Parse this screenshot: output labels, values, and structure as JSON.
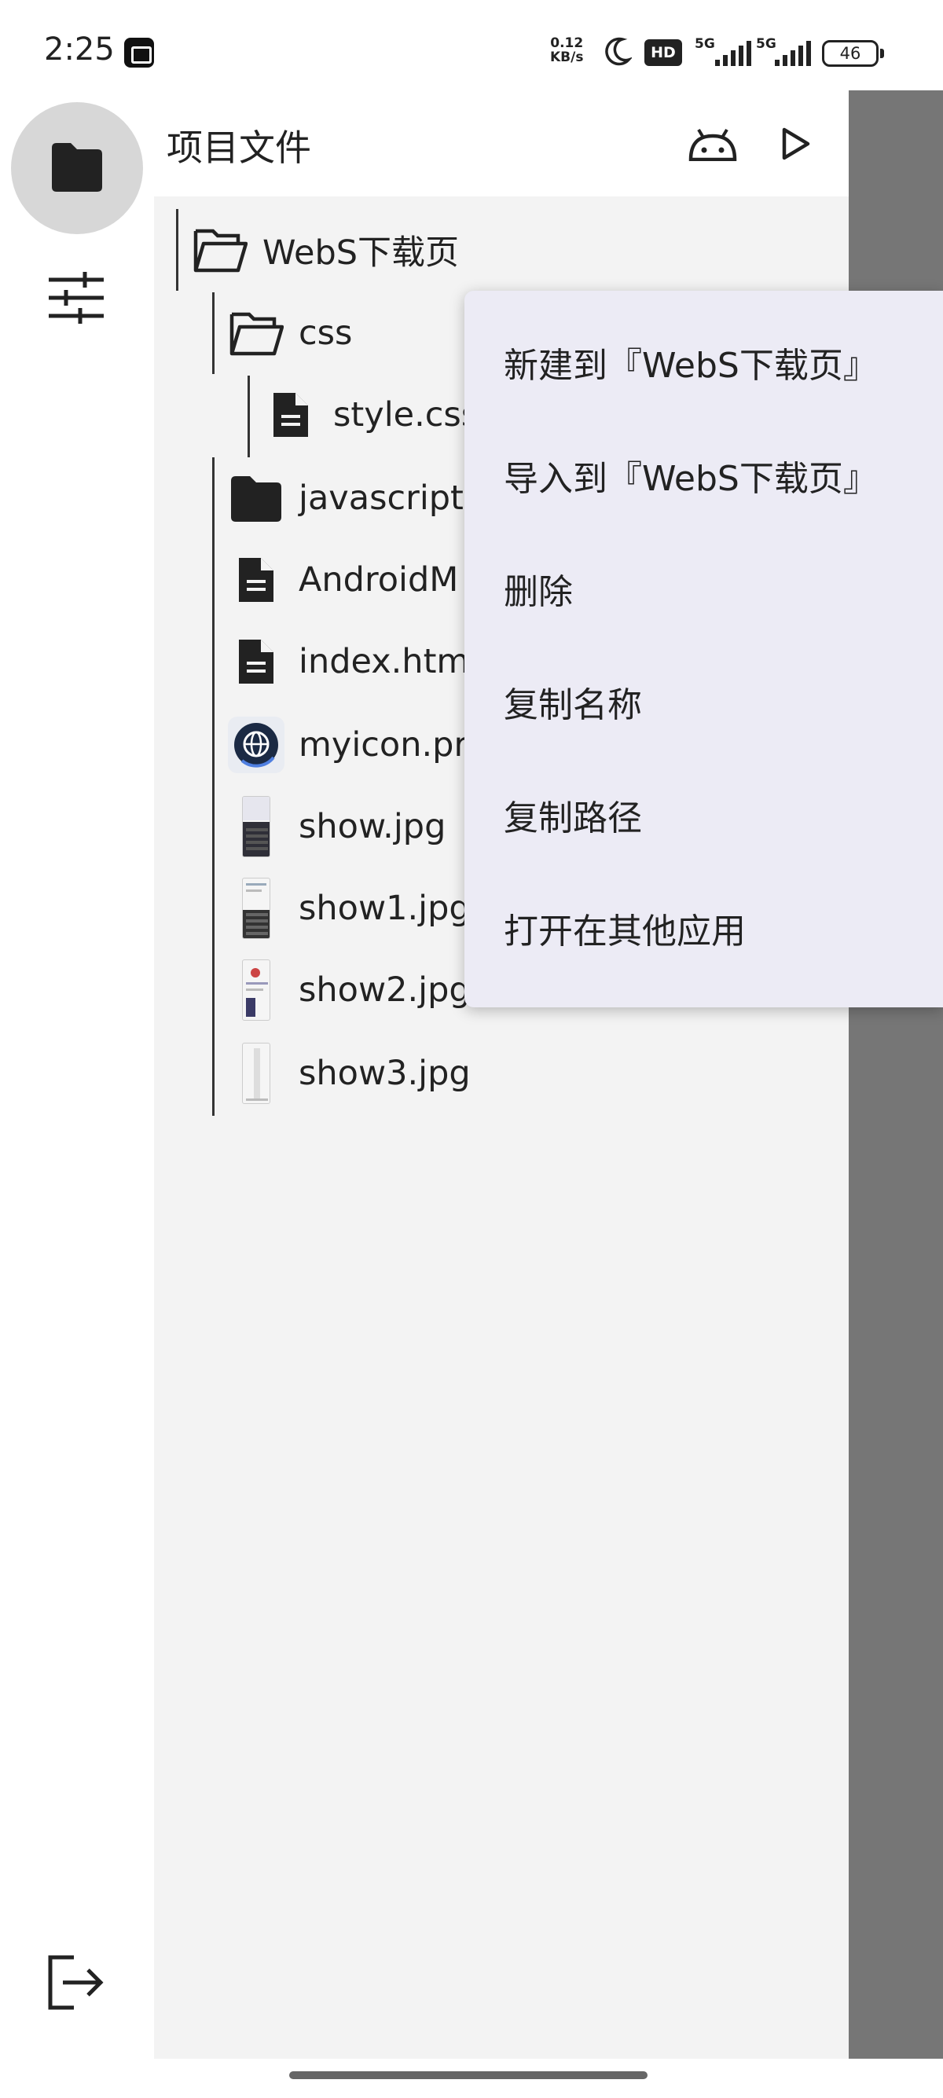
{
  "status_bar": {
    "time": "2:25",
    "speed_value": "0.12",
    "speed_unit": "KB/s",
    "hd_badge": "HD",
    "sim1_tag": "5G",
    "sim2_tag": "5G",
    "battery": "46"
  },
  "rail": {
    "files_icon": "folder-icon",
    "settings_icon": "tune-icon",
    "logout_icon": "logout-icon"
  },
  "header": {
    "title": "项目文件",
    "android_icon": "android-icon",
    "run_icon": "play-icon"
  },
  "tree": {
    "root": {
      "label": "WebS下载页",
      "icon": "folder-open-icon"
    },
    "items": [
      {
        "label": "css",
        "icon": "folder-open-icon"
      },
      {
        "label": "style.css",
        "icon": "file-icon"
      },
      {
        "label": "javascript",
        "icon": "folder-icon"
      },
      {
        "label": "AndroidM",
        "icon": "file-icon"
      },
      {
        "label": "index.htm",
        "icon": "file-icon"
      },
      {
        "label": "myicon.pr",
        "icon": "globe-icon"
      },
      {
        "label": "show.jpg",
        "icon": "image-thumbnail"
      },
      {
        "label": "show1.jpg",
        "icon": "image-thumbnail"
      },
      {
        "label": "show2.jpg",
        "icon": "image-thumbnail"
      },
      {
        "label": "show3.jpg",
        "icon": "image-thumbnail"
      }
    ]
  },
  "context_menu": {
    "items": [
      "新建到『WebS下载页』",
      "导入到『WebS下载页』",
      "删除",
      "复制名称",
      "复制路径",
      "打开在其他应用"
    ]
  },
  "colors": {
    "panel_bg": "#f3f3f3",
    "scrim": "#767676",
    "menu_bg": "#ecebf5",
    "rail_selected": "#d7d7d7"
  }
}
